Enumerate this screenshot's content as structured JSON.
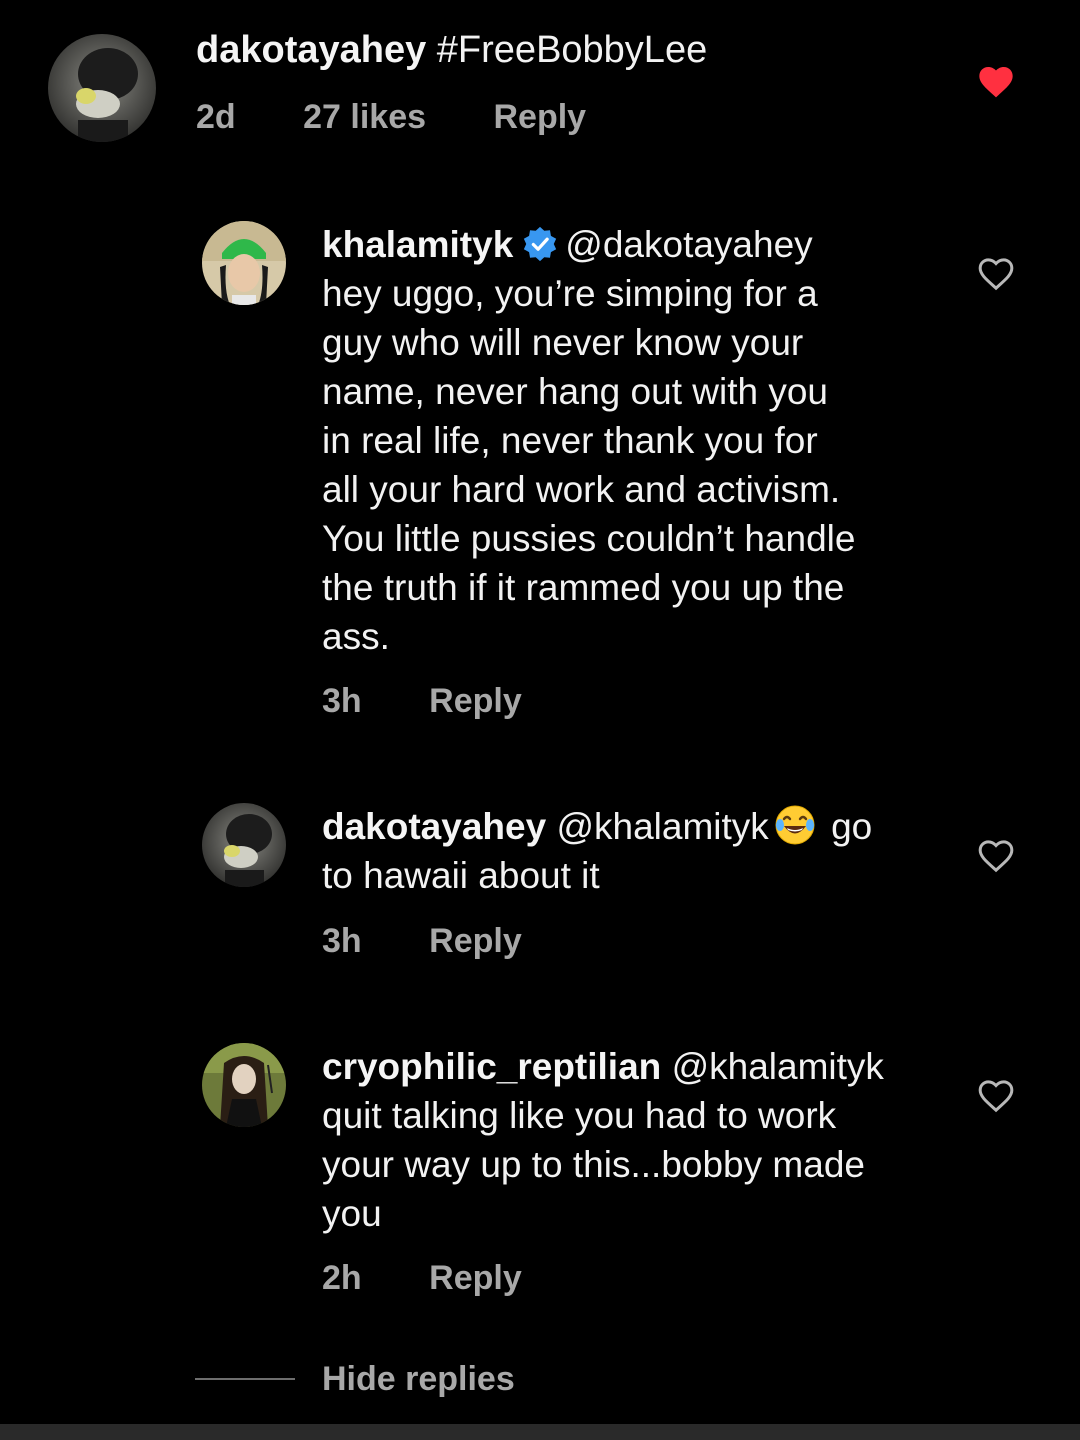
{
  "comments": [
    {
      "username": "dakotayahey",
      "mention": "",
      "text": "#FreeBobbyLee",
      "time": "2d",
      "likes": "27 likes",
      "reply_label": "Reply",
      "liked": true,
      "avatar_icon": "user-avatar-masked-photo"
    },
    {
      "username": "khalamityk",
      "verified": true,
      "mention": "@dakotayahey",
      "lines": [
        "hey uggo, you’re simping for a",
        "guy who will never know your",
        "name, never hang out with you",
        "in real life, never thank you for",
        "all your hard work and activism.",
        "You little pussies couldn’t handle",
        "the truth if it rammed you up the",
        "ass."
      ],
      "time": "3h",
      "reply_label": "Reply",
      "liked": false,
      "avatar_icon": "user-avatar-green-beanie-photo"
    },
    {
      "username": "dakotayahey",
      "mention": "@khalamityk",
      "emoji": "laughing-tears-emoji",
      "line1_tail": "go",
      "line2": "to hawaii about it",
      "time": "3h",
      "reply_label": "Reply",
      "liked": false,
      "avatar_icon": "user-avatar-masked-photo"
    },
    {
      "username": "cryophilic_reptilian",
      "mention": "@khalamityk",
      "lines": [
        "quit talking like you had to work",
        "your way up to this...bobby made",
        "you"
      ],
      "time": "2h",
      "reply_label": "Reply",
      "liked": false,
      "avatar_icon": "user-avatar-long-hair-photo"
    }
  ],
  "hide_replies_label": "Hide replies",
  "colors": {
    "background": "#000000",
    "text": "#f2f2f2",
    "meta": "#a8a8a8",
    "heart_liked": "#ff3040",
    "verified": "#3897f0"
  }
}
